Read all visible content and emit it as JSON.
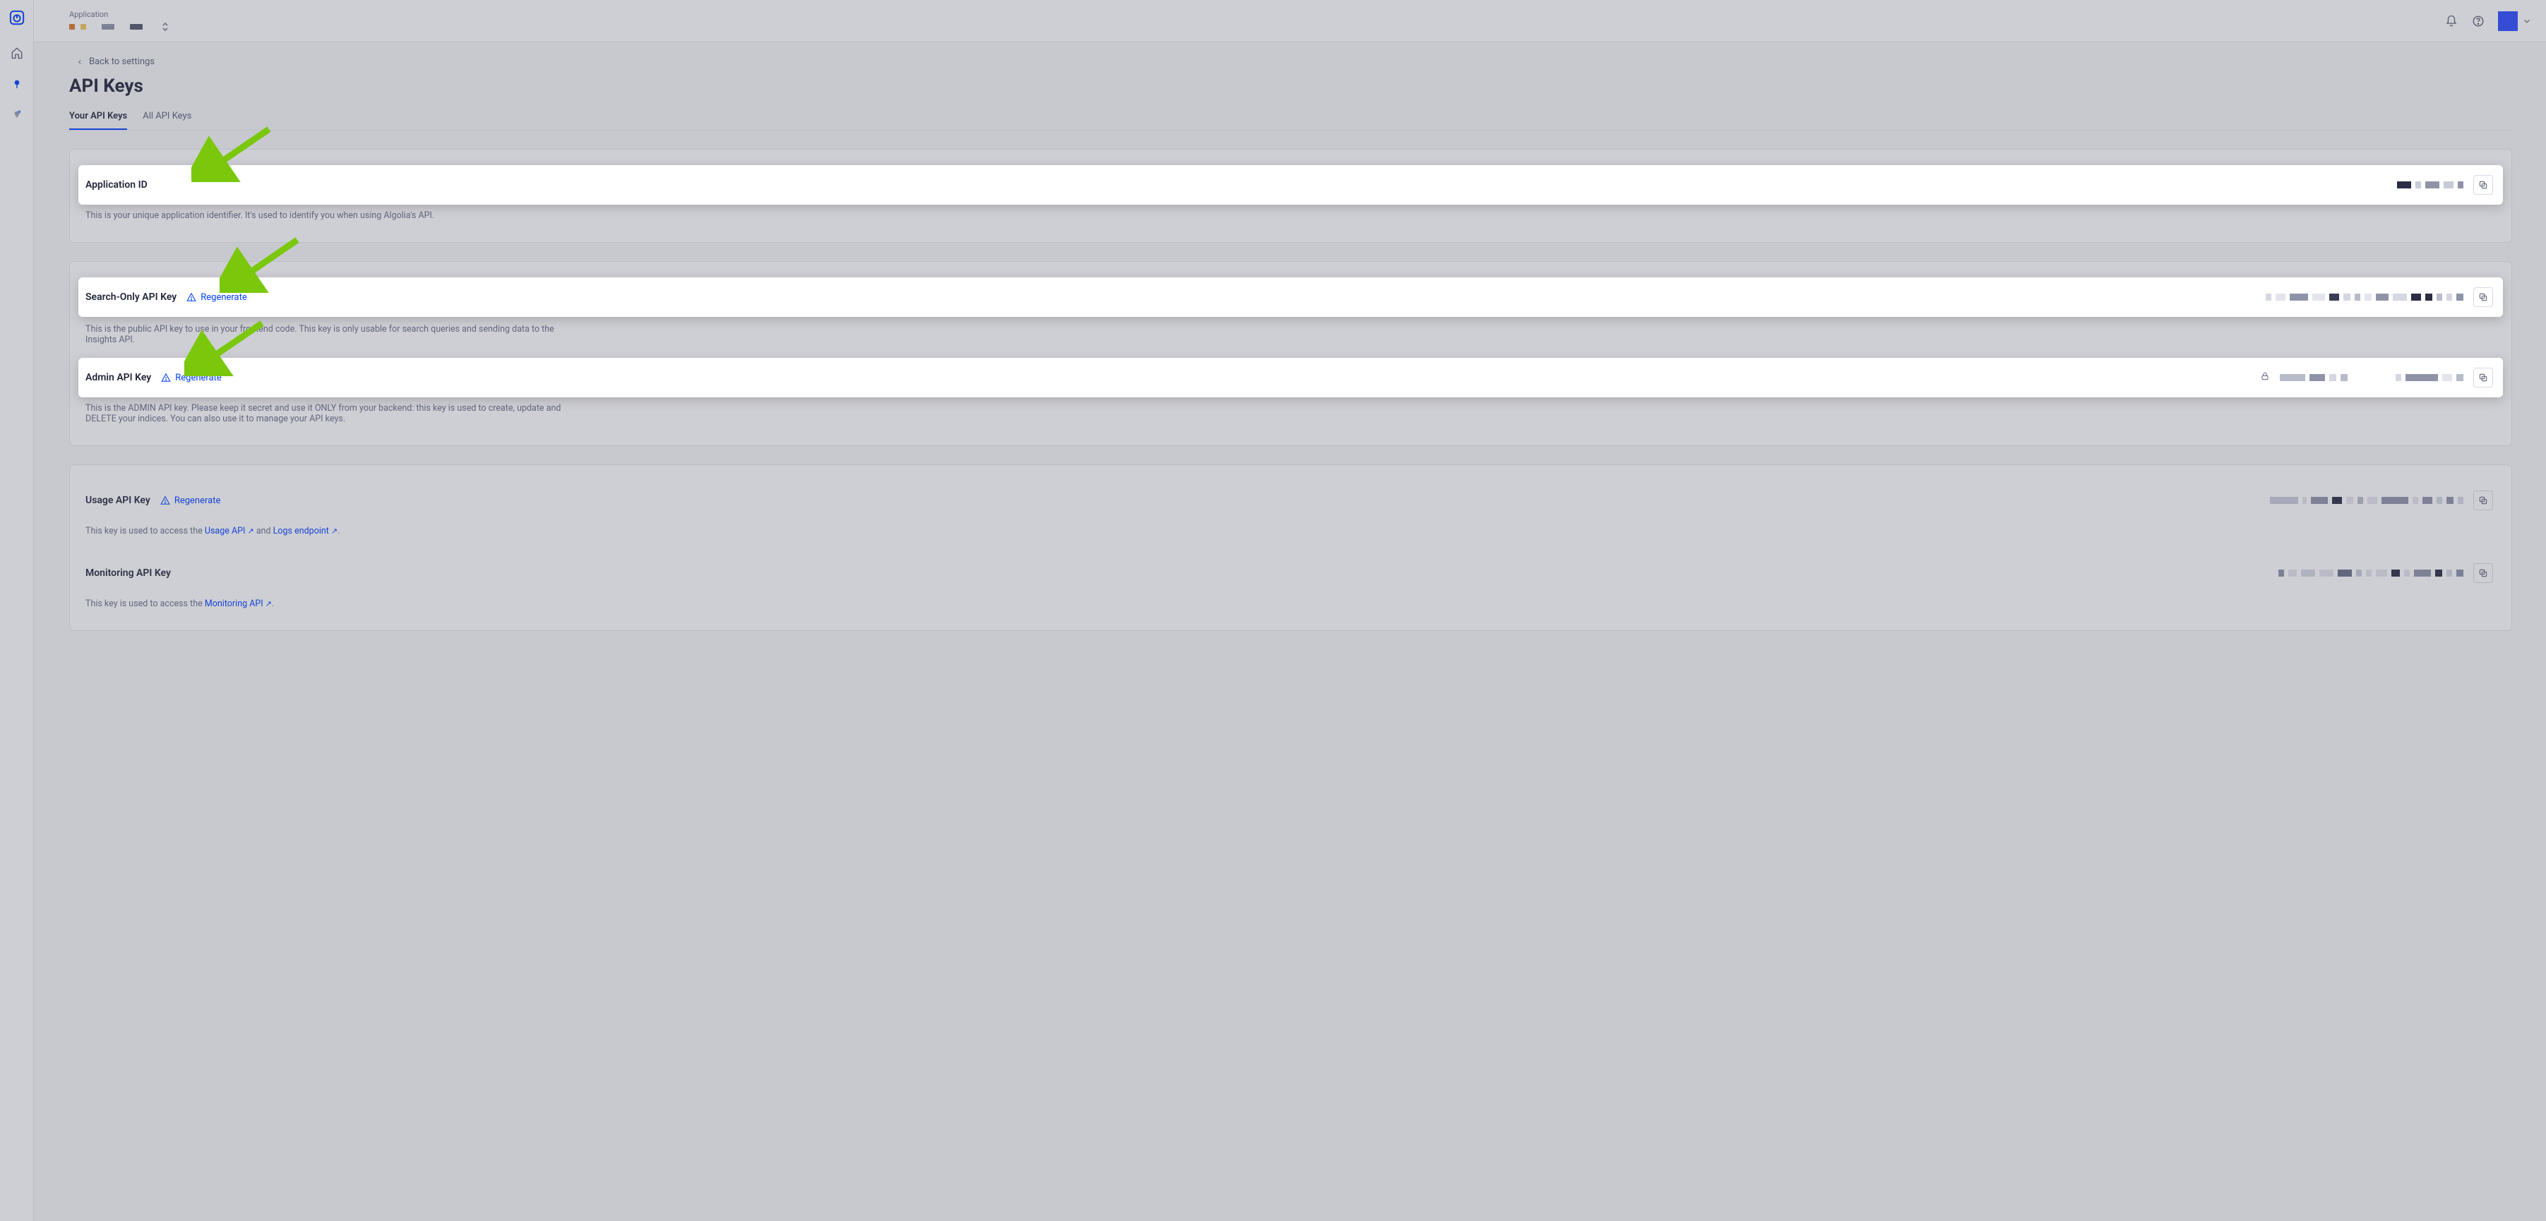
{
  "topbar": {
    "application_label": "Application"
  },
  "nav": {
    "back_label": "Back to settings"
  },
  "page": {
    "title": "API Keys"
  },
  "tabs": {
    "your": "Your API Keys",
    "all": "All API Keys"
  },
  "sections": {
    "app_id": {
      "title": "Application ID",
      "desc": "This is your unique application identifier. It's used to identify you when using Algolia's API."
    },
    "search_only": {
      "title": "Search-Only API Key",
      "regenerate": "Regenerate",
      "desc": "This is the public API key to use in your frontend code. This key is only usable for search queries and sending data to the Insights API."
    },
    "admin": {
      "title": "Admin API Key",
      "regenerate": "Regenerate",
      "desc": "This is the ADMIN API key. Please keep it secret and use it ONLY from your backend: this key is used to create, update and DELETE your indices. You can also use it to manage your API keys."
    },
    "usage": {
      "title": "Usage API Key",
      "regenerate": "Regenerate",
      "desc_pre": "This key is used to access the ",
      "link1": "Usage API",
      "desc_mid": " and ",
      "link2": "Logs endpoint",
      "desc_post": "."
    },
    "monitoring": {
      "title": "Monitoring API Key",
      "desc_pre": "This key is used to access the ",
      "link": "Monitoring API",
      "desc_post": "."
    }
  },
  "colors": {
    "accent": "#003dff",
    "arrow": "#7ac70c"
  }
}
